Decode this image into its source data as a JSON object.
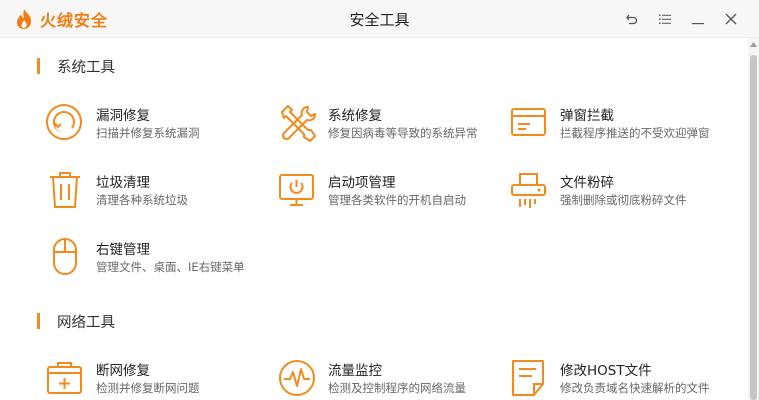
{
  "app": {
    "brand_name": "火绒安全",
    "window_title": "安全工具",
    "accent_color": "#f28a1c"
  },
  "window_controls": [
    {
      "icon": "back-arrow-icon"
    },
    {
      "icon": "menu-icon"
    },
    {
      "icon": "minimize-icon"
    },
    {
      "icon": "close-icon"
    }
  ],
  "sections": [
    {
      "title": "系统工具",
      "tools": [
        {
          "title": "漏洞修复",
          "desc": "扫描并修复系统漏洞",
          "icon": "vulnerability-fix-icon"
        },
        {
          "title": "系统修复",
          "desc": "修复因病毒等导致的系统异常",
          "icon": "wrench-screwdriver-icon"
        },
        {
          "title": "弹窗拦截",
          "desc": "拦截程序推送的不受欢迎弹窗",
          "icon": "popup-window-icon"
        },
        {
          "title": "垃圾清理",
          "desc": "清理各种系统垃圾",
          "icon": "trash-can-icon"
        },
        {
          "title": "启动项管理",
          "desc": "管理各类软件的开机自启动",
          "icon": "monitor-power-icon"
        },
        {
          "title": "文件粉碎",
          "desc": "强制删除或彻底粉碎文件",
          "icon": "shredder-icon"
        },
        {
          "title": "右键管理",
          "desc": "管理文件、桌面、IE右键菜单",
          "icon": "mouse-icon"
        }
      ]
    },
    {
      "title": "网络工具",
      "tools": [
        {
          "title": "断网修复",
          "desc": "检测并修复断网问题",
          "icon": "medical-kit-icon"
        },
        {
          "title": "流量监控",
          "desc": "检测及控制程序的网络流量",
          "icon": "traffic-monitor-icon"
        },
        {
          "title": "修改HOST文件",
          "desc": "修改负责域名快速解析的文件",
          "icon": "document-edit-icon"
        }
      ]
    }
  ]
}
